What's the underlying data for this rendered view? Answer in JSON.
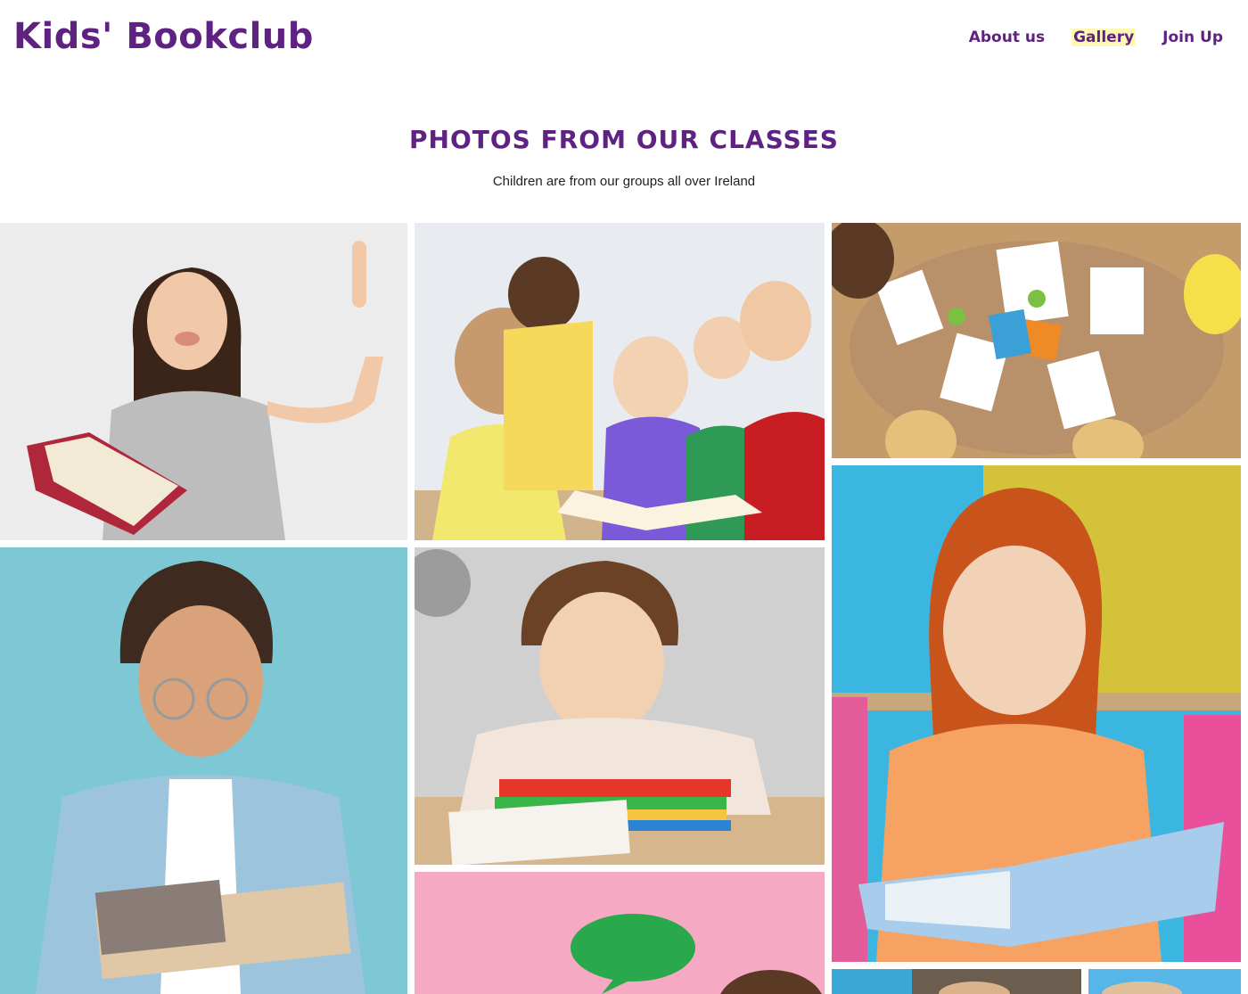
{
  "brand": {
    "title": "Kids' Bookclub"
  },
  "nav": {
    "items": [
      {
        "label": "About us"
      },
      {
        "label": "Gallery"
      },
      {
        "label": "Join Up"
      }
    ],
    "active": "Gallery"
  },
  "section": {
    "title": "PHOTOS FROM OUR CLASSES",
    "subtitle": "Children are from our groups all over Ireland"
  },
  "colors": {
    "brand": "#5f2182",
    "active_highlight": "#fdf8b4"
  },
  "gallery": {
    "photos": [
      {
        "name": "photo-girl-raising-finger-with-book"
      },
      {
        "name": "photo-children-reading-together"
      },
      {
        "name": "photo-children-drawing-at-table"
      },
      {
        "name": "photo-boy-with-glasses-reading"
      },
      {
        "name": "photo-smiling-girl-on-books"
      },
      {
        "name": "photo-redhead-girl-with-book"
      },
      {
        "name": "photo-pink-speech-bubble"
      },
      {
        "name": "photo-partial-bottom-right-1"
      },
      {
        "name": "photo-partial-bottom-right-2"
      }
    ]
  }
}
